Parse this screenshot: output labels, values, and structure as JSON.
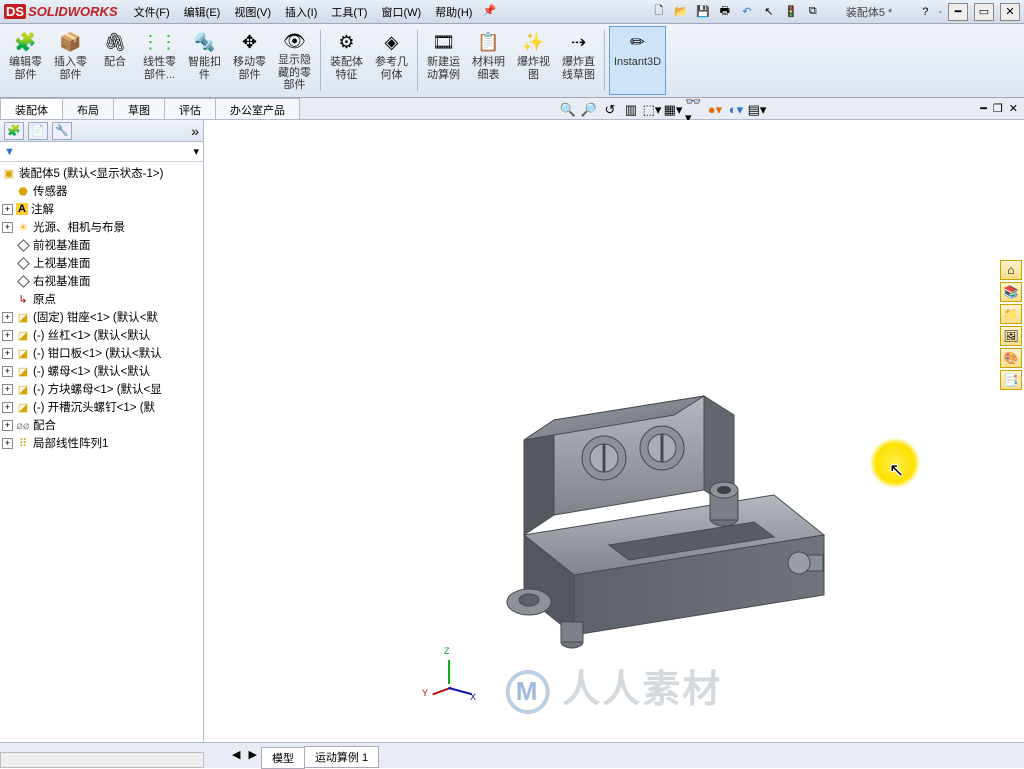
{
  "app": {
    "brand": "SOLIDWORKS",
    "doc_title": "装配体5 *"
  },
  "menu": {
    "file": "文件(F)",
    "edit": "编辑(E)",
    "view": "视图(V)",
    "insert": "插入(I)",
    "tools": "工具(T)",
    "window": "窗口(W)",
    "help": "帮助(H)"
  },
  "ribbon": {
    "edit_part": "编辑零\n部件",
    "insert_comp": "插入零\n部件",
    "mate": "配合",
    "linear_comp": "线性零\n部件...",
    "smart_fast": "智能扣\n件",
    "move_comp": "移动零\n部件",
    "show_hidden": "显示隐\n藏的零\n部件",
    "asm_feat": "装配体\n特征",
    "ref_geom": "参考几\n何体",
    "motion": "新建运\n动算例",
    "bom": "材料明\n细表",
    "exploded": "爆炸视\n图",
    "explode_line": "爆炸直\n线草图",
    "instant3d": "Instant3D"
  },
  "cmdtabs": {
    "assembly": "装配体",
    "layout": "布局",
    "sketch": "草图",
    "evaluate": "评估",
    "office": "办公室产品"
  },
  "tree": {
    "root": "装配体5   (默认<显示状态-1>)",
    "sensors": "传感器",
    "annotations": "注解",
    "lights": "光源、相机与布景",
    "front": "前视基准面",
    "top": "上视基准面",
    "right": "右视基准面",
    "origin": "原点",
    "p1": "(固定) 钳座<1> (默认<默",
    "p2": "(-) 丝杠<1> (默认<默认",
    "p3": "(-) 钳口板<1> (默认<默认",
    "p4": "(-) 螺母<1> (默认<默认",
    "p5": "(-) 方块螺母<1> (默认<显",
    "p6": "(-) 开槽沉头螺钉<1> (默",
    "mates": "配合",
    "pattern": "局部线性阵列1"
  },
  "bottom_tabs": {
    "model": "模型",
    "motion1": "运动算例 1"
  },
  "watermark": "人人素材",
  "triad": {
    "x": "X",
    "y": "Y",
    "z": "Z"
  },
  "help_hint": "?"
}
